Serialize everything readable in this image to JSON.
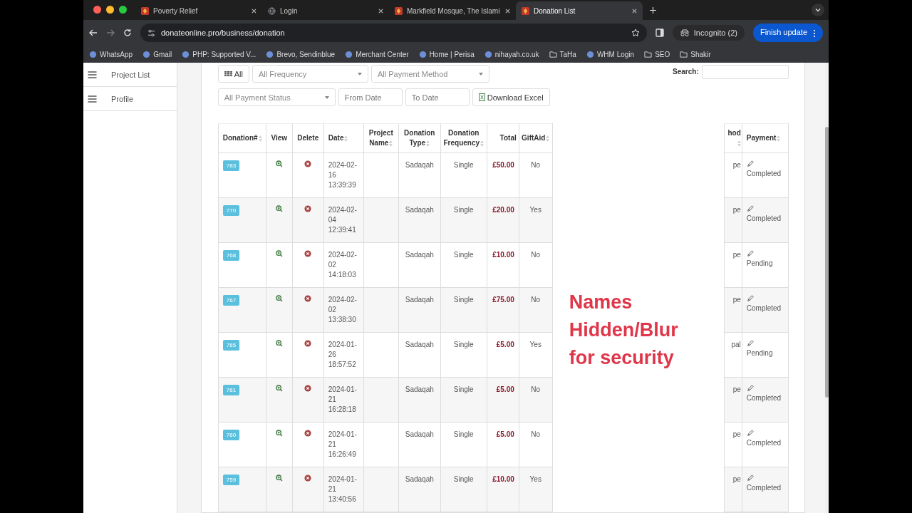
{
  "browser": {
    "tabs": [
      {
        "title": "Poverty Relief",
        "kind": "logo",
        "selected": false
      },
      {
        "title": "Login",
        "kind": "globe",
        "selected": false
      },
      {
        "title": "Markfield Mosque, The Islami",
        "kind": "logo",
        "selected": false
      },
      {
        "title": "Donation List",
        "kind": "logo",
        "selected": true
      }
    ],
    "address": "donateonline.pro/business/donation",
    "incognito": "Incognito (2)",
    "update_button": "Finish update",
    "bookmarks": [
      {
        "label": "WhatsApp",
        "kind": "site"
      },
      {
        "label": "Gmail",
        "kind": "site"
      },
      {
        "label": "PHP: Supported V...",
        "kind": "site"
      },
      {
        "label": "Brevo, Sendinblue",
        "kind": "site"
      },
      {
        "label": "Merchant Center",
        "kind": "site"
      },
      {
        "label": "Home | Perisa",
        "kind": "site"
      },
      {
        "label": "nihayah.co.uk",
        "kind": "site"
      },
      {
        "label": "TaHa",
        "kind": "folder"
      },
      {
        "label": "WHM Login",
        "kind": "site"
      },
      {
        "label": "SEO",
        "kind": "folder"
      },
      {
        "label": "Shakir",
        "kind": "folder"
      }
    ]
  },
  "sidebar": {
    "items": [
      {
        "label": "Project List"
      },
      {
        "label": "Profile"
      }
    ]
  },
  "filters": {
    "all_button": "All",
    "frequency": "All Frequency",
    "method": "All Payment Method",
    "status": "All Payment Status",
    "from_date": {
      "placeholder": "From Date"
    },
    "to_date": {
      "placeholder": "To Date"
    },
    "download_button": "Download Excel",
    "search_label": "Search:"
  },
  "table": {
    "columns": [
      {
        "label": "Donation#",
        "sortable": true
      },
      {
        "label": "View",
        "sortable": false
      },
      {
        "label": "Delete",
        "sortable": false
      },
      {
        "label": "Date",
        "sortable": true
      },
      {
        "label": "Project Name",
        "sortable": true
      },
      {
        "label": "Donation Type",
        "sortable": true
      },
      {
        "label": "Donation Frequency",
        "sortable": true
      },
      {
        "label": "Total",
        "sortable": false
      },
      {
        "label": "GiftAid",
        "sortable": true
      },
      {
        "label": "hod",
        "sortable": true
      },
      {
        "label": "Payment",
        "sortable": true
      }
    ],
    "redaction_note": "Names Hidden/Blur for security",
    "rows": [
      {
        "id": "783",
        "date": "2024-02-16 13:39:39",
        "type": "Sadaqah",
        "frequency": "Single",
        "total": "£50.00",
        "gift_aid": "No",
        "method": "pe",
        "payment": "Completed"
      },
      {
        "id": "770",
        "date": "2024-02-04 12:39:41",
        "type": "Sadaqah",
        "frequency": "Single",
        "total": "£20.00",
        "gift_aid": "Yes",
        "method": "pe",
        "payment": "Completed"
      },
      {
        "id": "768",
        "date": "2024-02-02 14:18:03",
        "type": "Sadaqah",
        "frequency": "Single",
        "total": "£10.00",
        "gift_aid": "No",
        "method": "pe",
        "payment": "Pending"
      },
      {
        "id": "767",
        "date": "2024-02-02 13:38:30",
        "type": "Sadaqah",
        "frequency": "Single",
        "total": "£75.00",
        "gift_aid": "No",
        "method": "pe",
        "payment": "Completed"
      },
      {
        "id": "765",
        "date": "2024-01-26 18:57:52",
        "type": "Sadaqah",
        "frequency": "Single",
        "total": "£5.00",
        "gift_aid": "Yes",
        "method": "pal",
        "payment": "Pending"
      },
      {
        "id": "761",
        "date": "2024-01-21 16:28:18",
        "type": "Sadaqah",
        "frequency": "Single",
        "total": "£5.00",
        "gift_aid": "No",
        "method": "pe",
        "payment": "Completed"
      },
      {
        "id": "760",
        "date": "2024-01-21 16:26:49",
        "type": "Sadaqah",
        "frequency": "Single",
        "total": "£5.00",
        "gift_aid": "No",
        "method": "pe",
        "payment": "Completed"
      },
      {
        "id": "759",
        "date": "2024-01-21 13:40:56",
        "type": "Sadaqah",
        "frequency": "Single",
        "total": "£10.00",
        "gift_aid": "Yes",
        "method": "pe",
        "payment": "Completed"
      }
    ]
  }
}
